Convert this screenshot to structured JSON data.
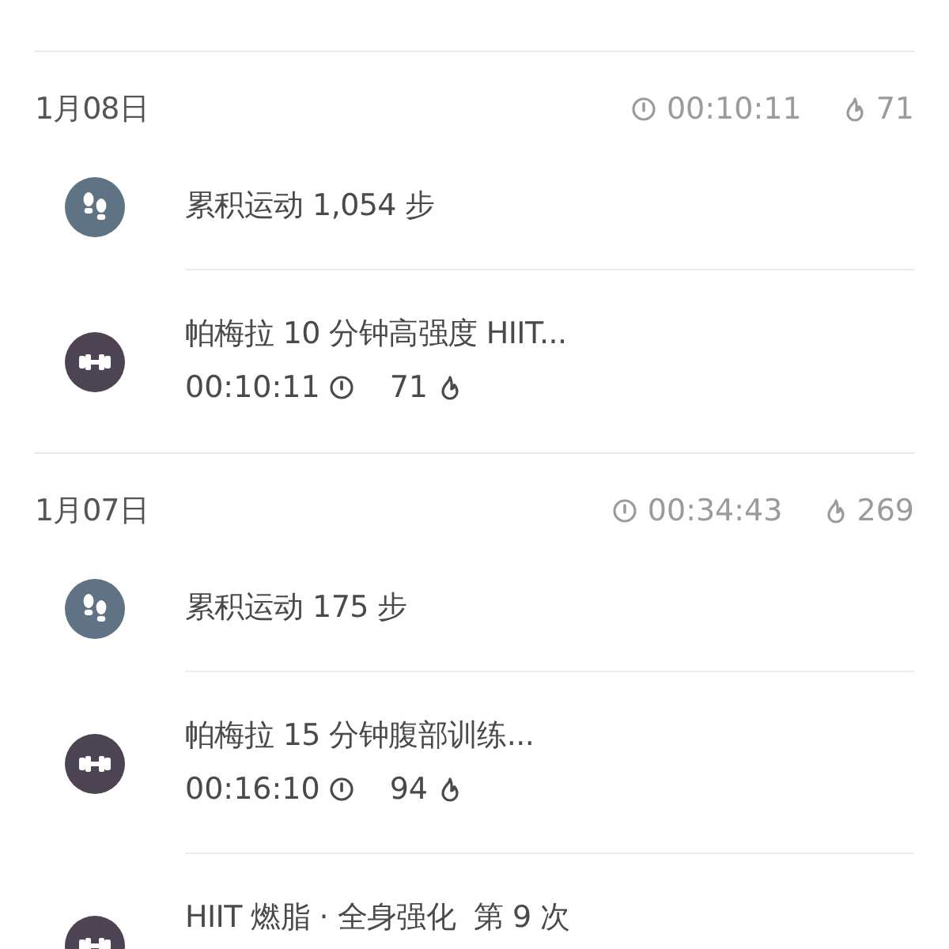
{
  "days": [
    {
      "date": "1月08日",
      "duration": "00:10:11",
      "calories": "71",
      "items": [
        {
          "kind": "steps",
          "title": "累积运动 1,054 步"
        },
        {
          "kind": "workout",
          "title": "帕梅拉 10 分钟高强度 HIIT...",
          "duration": "00:10:11",
          "calories": "71"
        }
      ]
    },
    {
      "date": "1月07日",
      "duration": "00:34:43",
      "calories": "269",
      "items": [
        {
          "kind": "steps",
          "title": "累积运动 175 步"
        },
        {
          "kind": "workout",
          "title": "帕梅拉 15 分钟腹部训练...",
          "duration": "00:16:10",
          "calories": "94"
        },
        {
          "kind": "workout",
          "title": "HIIT 燃脂 · 全身强化  第 9 次"
        }
      ]
    }
  ]
}
